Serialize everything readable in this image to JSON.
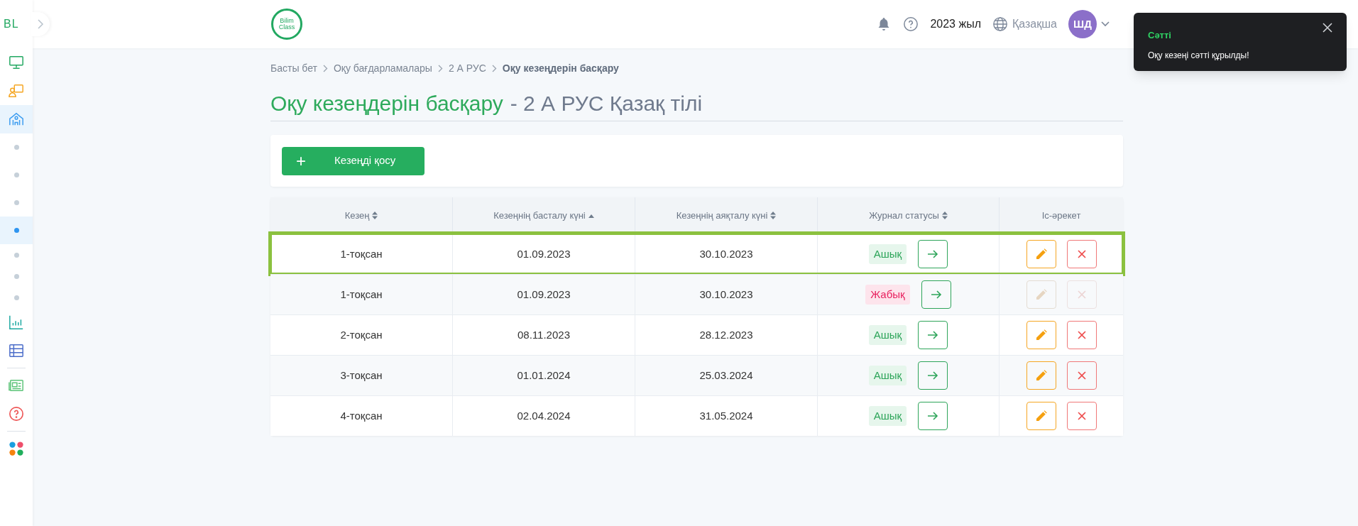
{
  "sidebar": {
    "logo": "BL",
    "items": [
      {
        "kind": "icon",
        "selected": false
      },
      {
        "kind": "icon",
        "selected": false
      },
      {
        "kind": "icon",
        "selected": true
      },
      {
        "kind": "dot",
        "selected": false
      },
      {
        "kind": "dot",
        "selected": false
      },
      {
        "kind": "dot",
        "selected": false
      },
      {
        "kind": "dot",
        "selected": true
      },
      {
        "kind": "dot",
        "selected": false
      },
      {
        "kind": "dot",
        "selected": false
      },
      {
        "kind": "dot",
        "selected": false
      },
      {
        "kind": "icon",
        "selected": false
      },
      {
        "kind": "icon",
        "selected": false
      },
      {
        "kind": "icon",
        "selected": false
      },
      {
        "kind": "icon",
        "selected": false
      },
      {
        "kind": "icon",
        "selected": false
      }
    ]
  },
  "header": {
    "logo": [
      "Bilim",
      "Class"
    ],
    "year": "2023 жыл",
    "language": "Қазақша",
    "avatar": "ШД"
  },
  "breadcrumb": [
    {
      "label": "Басты бет",
      "current": false
    },
    {
      "label": "Оқу бағдарламалары",
      "current": false
    },
    {
      "label": "2 А РУС",
      "current": false
    },
    {
      "label": "Оқу кезеңдерін басқару",
      "current": true
    }
  ],
  "title": {
    "main": "Оқу кезеңдерін басқару",
    "sub": "- 2 А РУС Қазақ тілі"
  },
  "add_button": {
    "icon": "+",
    "label": "Кезеңді қосу"
  },
  "table": {
    "columns": [
      {
        "label": "Кезең",
        "sortable": true,
        "sorted": false
      },
      {
        "label": "Кезеңнің басталу күні",
        "sortable": true,
        "sorted": true
      },
      {
        "label": "Кезеңнің аяқталу күні",
        "sortable": true,
        "sorted": false
      },
      {
        "label": "Журнал статусы",
        "sortable": true,
        "sorted": false
      },
      {
        "label": "Іс-әрекет",
        "sortable": false
      }
    ],
    "rows": [
      {
        "period": "1-тоқсан",
        "start": "01.09.2023",
        "end": "30.10.2023",
        "status": {
          "kind": "open",
          "label": "Ашық"
        },
        "actions_disabled": false,
        "highlighted": true
      },
      {
        "period": "1-тоқсан",
        "start": "01.09.2023",
        "end": "30.10.2023",
        "status": {
          "kind": "closed",
          "label": "Жабық"
        },
        "actions_disabled": true,
        "highlighted": false
      },
      {
        "period": "2-тоқсан",
        "start": "08.11.2023",
        "end": "28.12.2023",
        "status": {
          "kind": "open",
          "label": "Ашық"
        },
        "actions_disabled": false,
        "highlighted": false
      },
      {
        "period": "3-тоқсан",
        "start": "01.01.2024",
        "end": "25.03.2024",
        "status": {
          "kind": "open",
          "label": "Ашық"
        },
        "actions_disabled": false,
        "highlighted": false
      },
      {
        "period": "4-тоқсан",
        "start": "02.04.2024",
        "end": "31.05.2024",
        "status": {
          "kind": "open",
          "label": "Ашық"
        },
        "actions_disabled": false,
        "highlighted": false
      }
    ]
  },
  "toast": {
    "title": "Сәтті",
    "message": "Оқу кезеңі сәтті құрылды!"
  }
}
